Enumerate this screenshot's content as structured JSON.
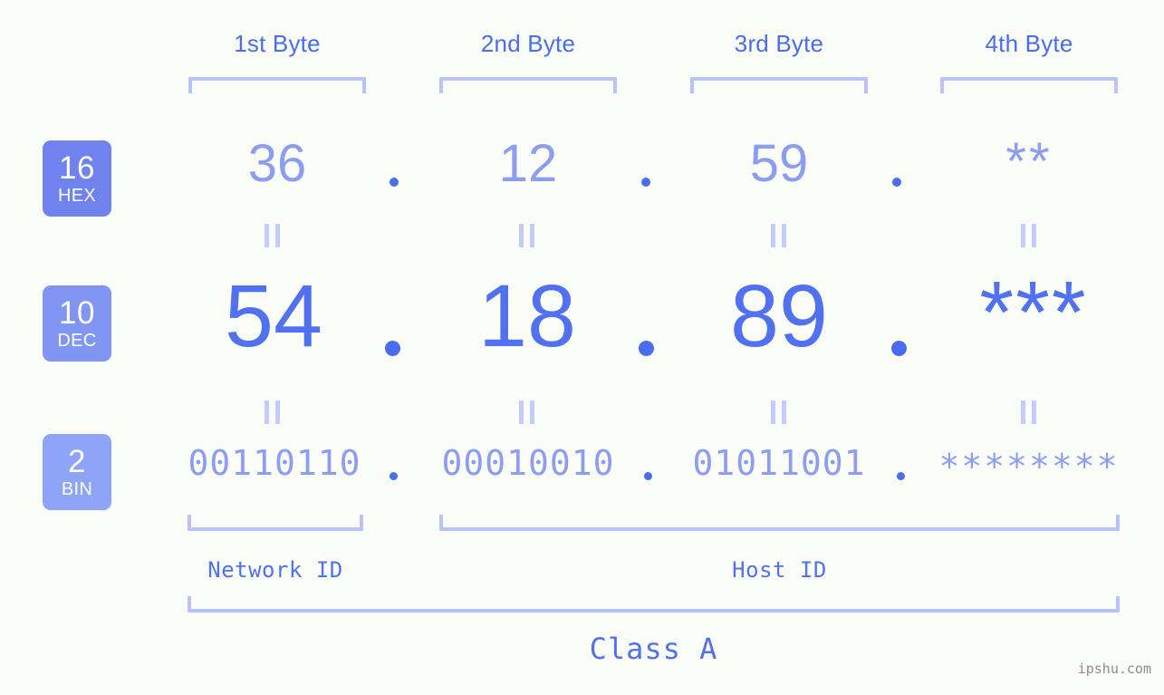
{
  "meta": {
    "watermark": "ipshu.com"
  },
  "headers": [
    {
      "label": "1st Byte"
    },
    {
      "label": "2nd Byte"
    },
    {
      "label": "3rd Byte"
    },
    {
      "label": "4th Byte"
    }
  ],
  "bases": [
    {
      "number": "16",
      "name": "HEX",
      "color": "#6f82ee"
    },
    {
      "number": "10",
      "name": "DEC",
      "color": "#8195f3"
    },
    {
      "number": "2",
      "name": "BIN",
      "color": "#8ea4f6"
    }
  ],
  "rows": {
    "hex": {
      "base_number": "16",
      "base_name": "HEX",
      "values": [
        "36",
        "12",
        "59",
        "**"
      ]
    },
    "dec": {
      "base_number": "10",
      "base_name": "DEC",
      "values": [
        "54",
        "18",
        "89",
        "***"
      ]
    },
    "bin": {
      "base_number": "2",
      "base_name": "BIN",
      "values": [
        "00110110",
        "00010010",
        "01011001",
        "********"
      ]
    }
  },
  "separators": {
    "dot": ".",
    "equals": "||"
  },
  "segments": {
    "network_id": "Network ID",
    "host_id": "Host ID",
    "class": "Class A"
  },
  "colors": {
    "background": "#fbfdf8",
    "accent_strong": "#5271f0",
    "accent_light": "#8d9df0",
    "bracket": "#b8c2fb",
    "badge_hex": "#6f82ee",
    "badge_dec": "#8195f3",
    "badge_bin": "#8ea4f6",
    "watermark": "#8d8d8d"
  }
}
